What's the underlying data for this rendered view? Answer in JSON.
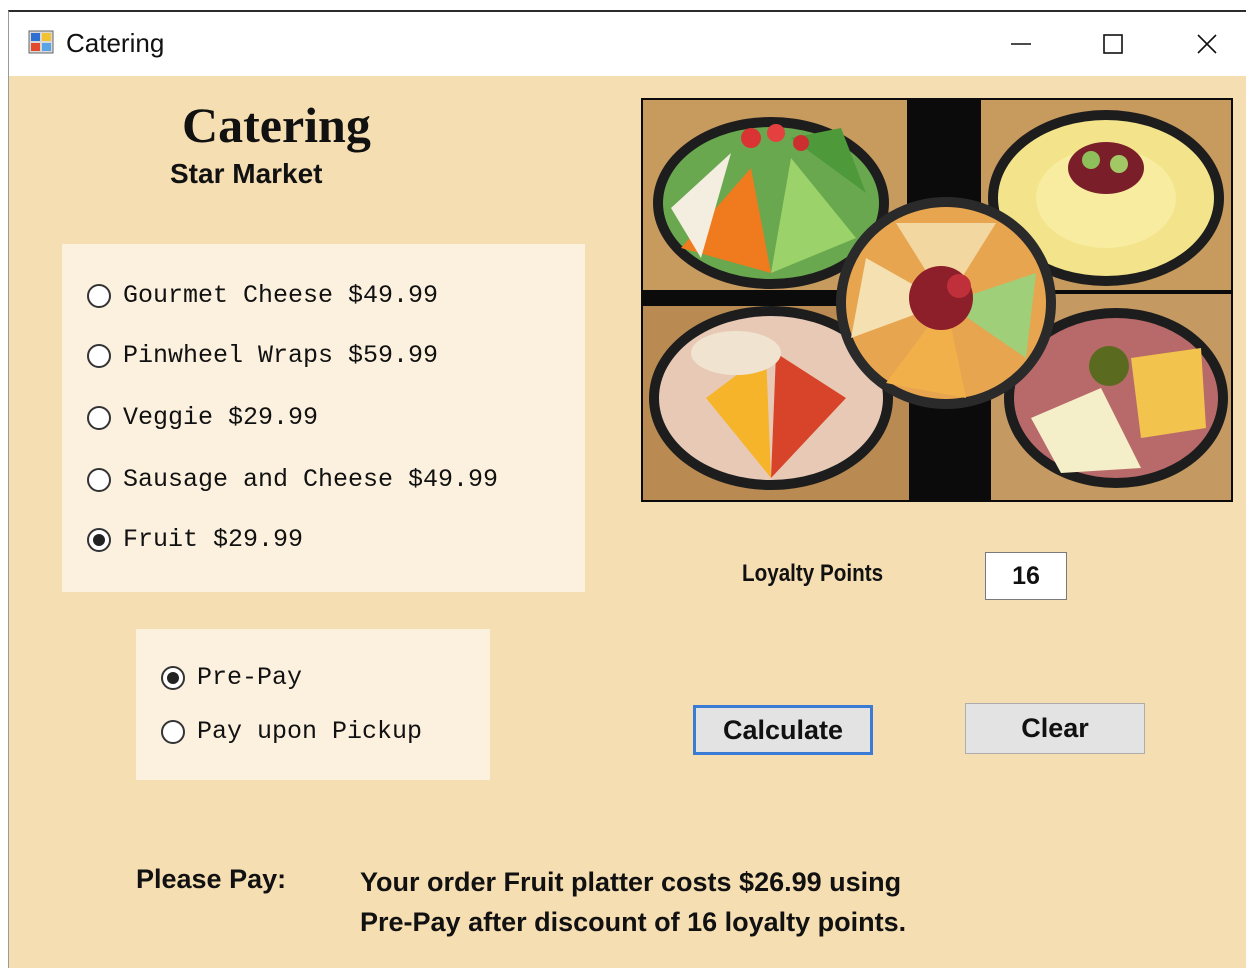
{
  "window": {
    "title": "Catering",
    "controls": [
      "minimize-icon",
      "maximize-icon",
      "close-icon"
    ]
  },
  "header": {
    "title": "Catering",
    "subtitle": "Star Market"
  },
  "menu_options": [
    {
      "label": "Gourmet Cheese $49.99",
      "checked": false
    },
    {
      "label": "Pinwheel Wraps $59.99",
      "checked": false
    },
    {
      "label": "Veggie $29.99",
      "checked": false
    },
    {
      "label": "Sausage and Cheese $49.99",
      "checked": false
    },
    {
      "label": "Fruit $29.99",
      "checked": true
    }
  ],
  "payment_options": [
    {
      "label": "Pre-Pay",
      "checked": true
    },
    {
      "label": "Pay upon Pickup",
      "checked": false
    }
  ],
  "loyalty": {
    "label": "Loyalty Points",
    "value": "16"
  },
  "buttons": {
    "calculate": "Calculate",
    "clear": "Clear"
  },
  "result": {
    "label": "Please Pay:",
    "line1": "Your order Fruit platter costs $26.99 using",
    "line2": "Pre-Pay after discount of 16 loyalty points."
  },
  "colors": {
    "form_background": "#f6deb3",
    "panel_background": "#fcf1df",
    "focus_accent": "#3a7bd5"
  }
}
